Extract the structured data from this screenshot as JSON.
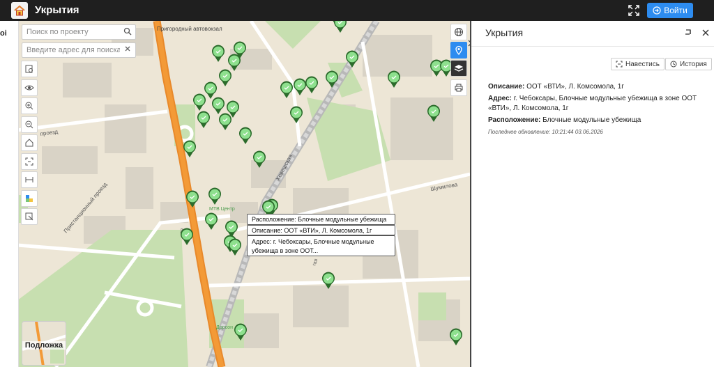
{
  "header": {
    "title": "Укрытия",
    "login_label": "Войти",
    "brand_color": "#1f1f1f",
    "accent_color": "#2d8cf0"
  },
  "left_strip": {
    "label": "оі"
  },
  "search": {
    "project_placeholder": "Поиск по проекту",
    "address_placeholder": "Введите адрес для поиска"
  },
  "toolbar": {
    "tools": [
      "select-icon",
      "eye-icon",
      "zoom-in-icon",
      "zoom-out-icon",
      "home-icon",
      "extent-icon",
      "measure-icon",
      "legend-icon",
      "draw-icon"
    ]
  },
  "right_tools": [
    "globe-icon",
    "location-pin-icon",
    "layers-icon",
    "print-icon"
  ],
  "basemap": {
    "label": "Подложка"
  },
  "map_labels": {
    "station": "Пригородный автовокзал",
    "street1": "Хевешская",
    "street2": "Шумилова",
    "street3": "Пристанционный проезд",
    "street4": "проезд",
    "mtv": "МТВ Центр",
    "park": "Дорсон",
    "street5": "ая",
    "street6": "гая"
  },
  "tooltip": {
    "location": "Расположение: Блочные модульные убежища",
    "description": "Описание: ООТ «ВТИ», Л. Комсомола, 1г",
    "address": "Адрес: г. Чебоксары, Блочные модульные убежища в зоне ООТ..."
  },
  "panel": {
    "title": "Укрытия",
    "navigate_label": "Навестись",
    "history_label": "История",
    "description_label": "Описание:",
    "description_value": "ООТ «ВТИ», Л. Комсомола, 1г",
    "address_label": "Адрес:",
    "address_value": "г. Чебоксары, Блочные модульные убежища в зоне ООТ «ВТИ», Л. Комсомола, 1г",
    "location_label": "Расположение:",
    "location_value": "Блочные модульные убежища",
    "updated": "Последнее обновление: 10:21:44 03.06.2026"
  },
  "marker_color": "#8ee08e"
}
